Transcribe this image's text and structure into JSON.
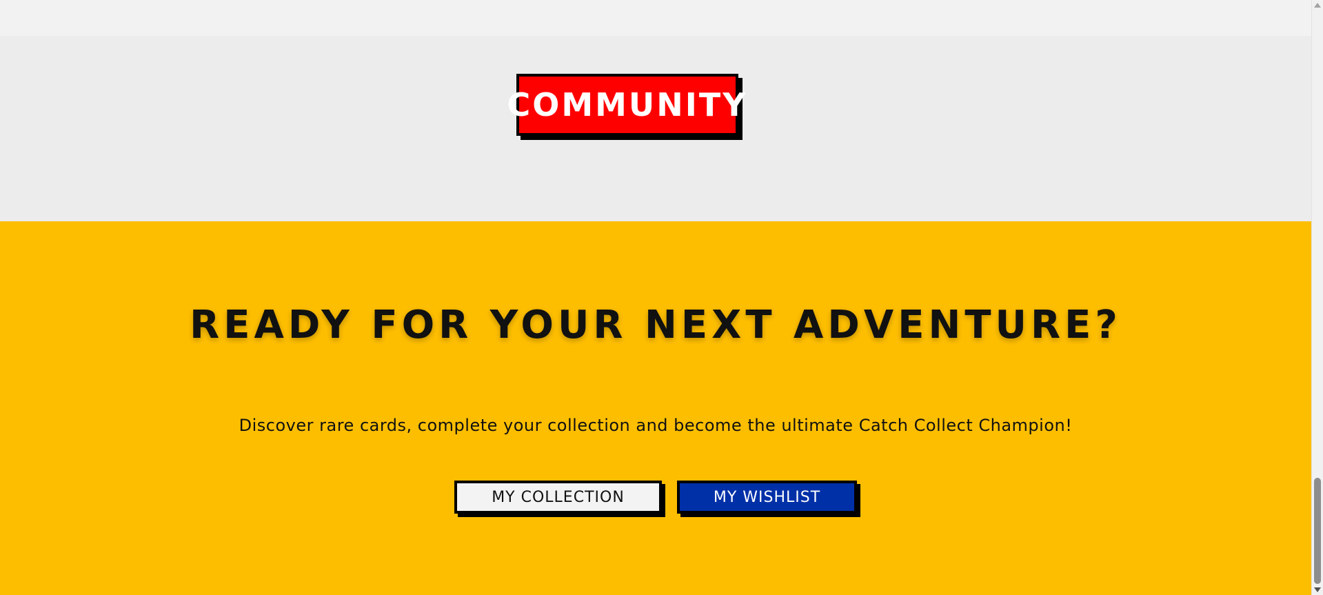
{
  "community": {
    "badge_label": "COMMUNITY"
  },
  "cta": {
    "title": "READY FOR YOUR NEXT ADVENTURE?",
    "subtitle": "Discover rare cards, complete your collection and become the ultimate Catch Collect Champion!",
    "collection_button": "MY COLLECTION",
    "wishlist_button": "MY WISHLIST"
  },
  "colors": {
    "badge_red": "#ff0000",
    "cta_yellow": "#febe00",
    "wishlist_blue": "#0030a8",
    "section_gray": "#ececed"
  },
  "scrollbar": {
    "up_icon": "scroll-up-arrow-icon",
    "down_icon": "scroll-down-arrow-icon"
  }
}
